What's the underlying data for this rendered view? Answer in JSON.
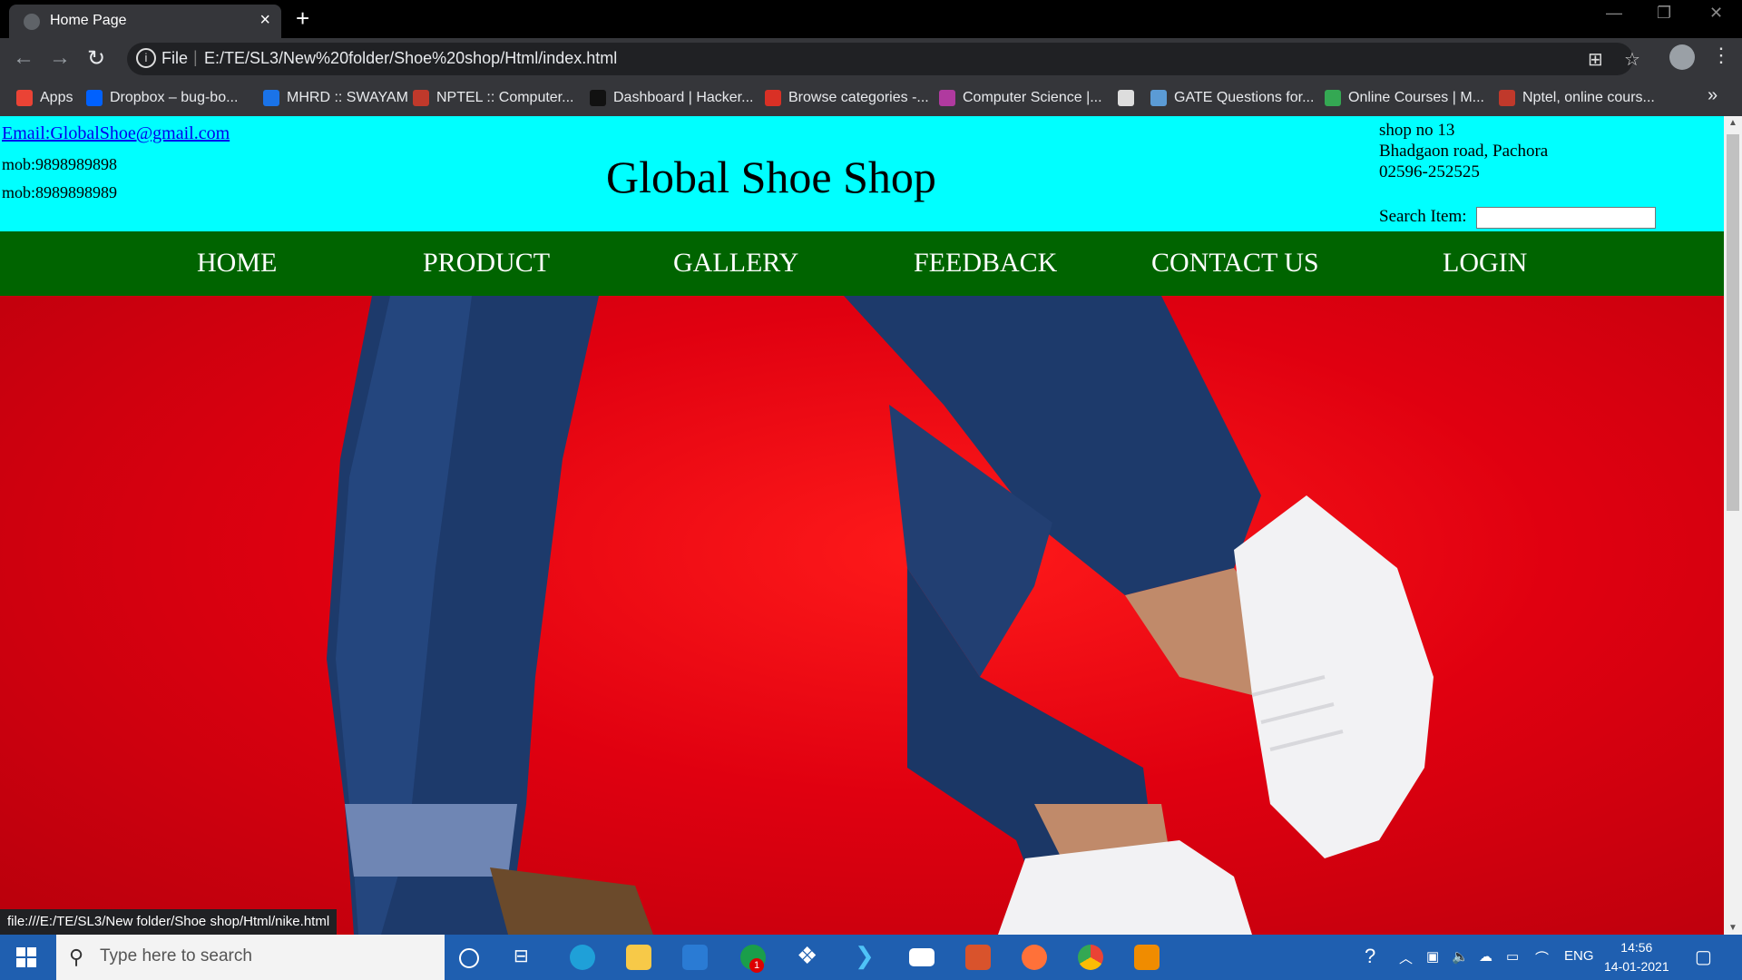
{
  "browser": {
    "tab_title": "Home Page",
    "new_tab": "+",
    "scheme": "File",
    "url": "E:/TE/SL3/New%20folder/Shoe%20shop/Html/index.html",
    "bookmarks": [
      {
        "label": "Apps",
        "color": "#ea4335"
      },
      {
        "label": "Dropbox – bug-bo...",
        "color": "#0061fe"
      },
      {
        "label": "MHRD :: SWAYAM",
        "color": "#1a73e8"
      },
      {
        "label": "NPTEL :: Computer...",
        "color": "#c0392b"
      },
      {
        "label": "Dashboard | Hacker...",
        "color": "#111111"
      },
      {
        "label": "Browse categories -...",
        "color": "#d93025"
      },
      {
        "label": "Computer Science |...",
        "color": "#b03a9f"
      },
      {
        "label": "",
        "color": "#dddddd"
      },
      {
        "label": "GATE Questions for...",
        "color": "#5b9bd5"
      },
      {
        "label": "Online Courses | M...",
        "color": "#34a853"
      },
      {
        "label": "Nptel, online cours...",
        "color": "#c0392b"
      }
    ],
    "more": "»",
    "status_url": "file:///E:/TE/SL3/New folder/Shoe shop/Html/nike.html"
  },
  "header": {
    "email": "Email:GlobalShoe@gmail.com",
    "mob1": "mob:9898989898",
    "mob2": "mob:8989898989",
    "title": "Global Shoe Shop",
    "address_line1": "shop no 13",
    "address_line2": "Bhadgaon road, Pachora",
    "phone": "02596-252525",
    "search_label": "Search Item:"
  },
  "nav": {
    "home": "HOME",
    "product": "PRODUCT",
    "gallery": "GALLERY",
    "feedback": "FEEDBACK",
    "contact": "CONTACT US",
    "login": "LOGIN"
  },
  "taskbar": {
    "search_placeholder": "Type here to search",
    "lang": "ENG",
    "time": "14:56",
    "date": "14-01-2021",
    "badge": "1"
  },
  "colors": {
    "header_bg": "#00ffff",
    "nav_bg": "#006400",
    "hero_red": "#e00010"
  }
}
